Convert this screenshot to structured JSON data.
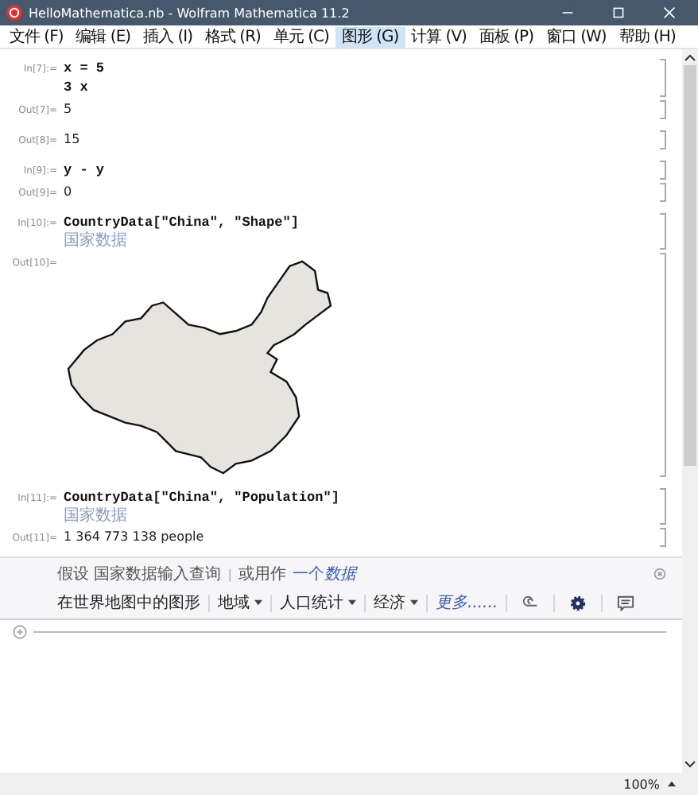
{
  "window": {
    "title": "HelloMathematica.nb - Wolfram Mathematica 11.2"
  },
  "menu": [
    {
      "label": "文件 (F)",
      "selected": false
    },
    {
      "label": "编辑 (E)",
      "selected": false
    },
    {
      "label": "插入 (I)",
      "selected": false
    },
    {
      "label": "格式 (R)",
      "selected": false
    },
    {
      "label": "单元 (C)",
      "selected": false
    },
    {
      "label": "图形 (G)",
      "selected": true
    },
    {
      "label": "计算 (V)",
      "selected": false
    },
    {
      "label": "面板 (P)",
      "selected": false
    },
    {
      "label": "窗口 (W)",
      "selected": false
    },
    {
      "label": "帮助 (H)",
      "selected": false
    }
  ],
  "cells": [
    {
      "kind": "input",
      "label": "In[7]:=",
      "lines": [
        "x = 5",
        "3 x"
      ]
    },
    {
      "kind": "output",
      "label": "Out[7]=",
      "lines": [
        "5"
      ]
    },
    {
      "kind": "output",
      "label": "Out[8]=",
      "lines": [
        "15"
      ]
    },
    {
      "kind": "input",
      "label": "In[9]:=",
      "lines": [
        "y - y"
      ]
    },
    {
      "kind": "output",
      "label": "Out[9]=",
      "lines": [
        "0"
      ]
    },
    {
      "kind": "input",
      "label": "In[10]:=",
      "lines": [
        "CountryData[\"China\", \"Shape\"]"
      ],
      "hint": "国家数据"
    },
    {
      "kind": "graphic",
      "label": "Out[10]="
    },
    {
      "kind": "input",
      "label": "In[11]:=",
      "lines": [
        "CountryData[\"China\", \"Population\"]"
      ],
      "hint": "国家数据"
    },
    {
      "kind": "output",
      "label": "Out[11]=",
      "lines": [
        "1 364 773 138 people"
      ]
    }
  ],
  "suggestions": {
    "assumption": "假设 国家数据输入查询",
    "separator": "|",
    "alternative": "或用作",
    "link": {
      "text": "一个",
      "emphasis": "数据"
    },
    "buttons": [
      {
        "label": "在世界地图中的图形",
        "kind": "plain"
      },
      {
        "label": "地域",
        "kind": "menu"
      },
      {
        "label": "人口统计",
        "kind": "menu"
      },
      {
        "label": "经济",
        "kind": "menu"
      },
      {
        "label": "更多......",
        "kind": "more"
      }
    ]
  },
  "status_bar": {
    "zoom": "100%"
  }
}
